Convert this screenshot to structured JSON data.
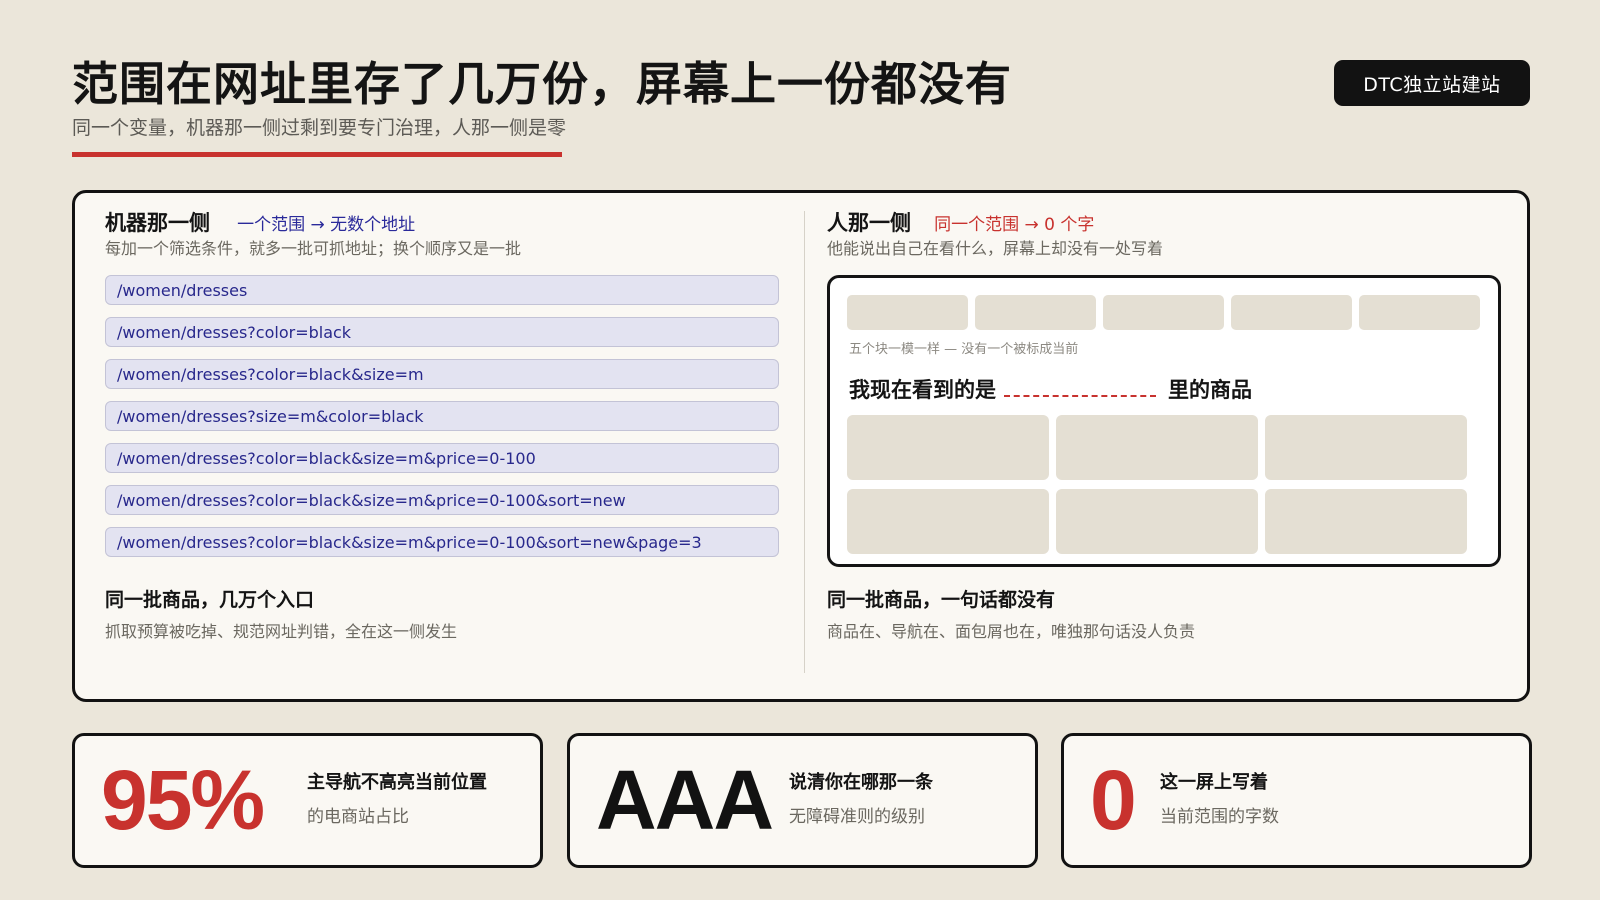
{
  "header": {
    "title": "范围在网址里存了几万份，屏幕上一份都没有",
    "subtitle": "同一个变量，机器那一侧过剩到要专门治理，人那一侧是零",
    "badge": "DTC独立站建站"
  },
  "left": {
    "lead": "机器那一侧",
    "tag": "一个范围 → 无数个地址",
    "desc": "每加一个筛选条件，就多一批可抓地址；换个顺序又是一批",
    "urls": [
      "/women/dresses",
      "/women/dresses?color=black",
      "/women/dresses?color=black&size=m",
      "/women/dresses?size=m&color=black",
      "/women/dresses?color=black&size=m&price=0-100",
      "/women/dresses?color=black&size=m&price=0-100&sort=new",
      "/women/dresses?color=black&size=m&price=0-100&sort=new&page=3"
    ],
    "foot_title": "同一批商品，几万个入口",
    "foot_desc": "抓取预算被吃掉、规范网址判错，全在这一侧发生"
  },
  "right": {
    "lead": "人那一侧",
    "tag": "同一个范围 → 0 个字",
    "desc": "他能说出自己在看什么，屏幕上却没有一处写着",
    "mock_caption": "五个块一模一样 — 没有一个被标成当前",
    "mock_question_before": "我现在看到的是",
    "mock_question_after": "里的商品",
    "foot_title": "同一批商品，一句话都没有",
    "foot_desc": "商品在、导航在、面包屑也在，唯独那句话没人负责"
  },
  "stats": [
    {
      "value": "95%",
      "title": "主导航不高亮当前位置",
      "desc": "的电商站占比",
      "color": "#c8322e"
    },
    {
      "value": "AAA",
      "title": "说清你在哪那一条",
      "desc": "无障碍准则的级别",
      "color": "#121212"
    },
    {
      "value": "0",
      "title": "这一屏上写着",
      "desc": "当前范围的字数",
      "color": "#c8322e"
    }
  ],
  "colors": {
    "accent_red": "#c8322e",
    "link_blue": "#28288c",
    "background": "#ebe6da"
  }
}
